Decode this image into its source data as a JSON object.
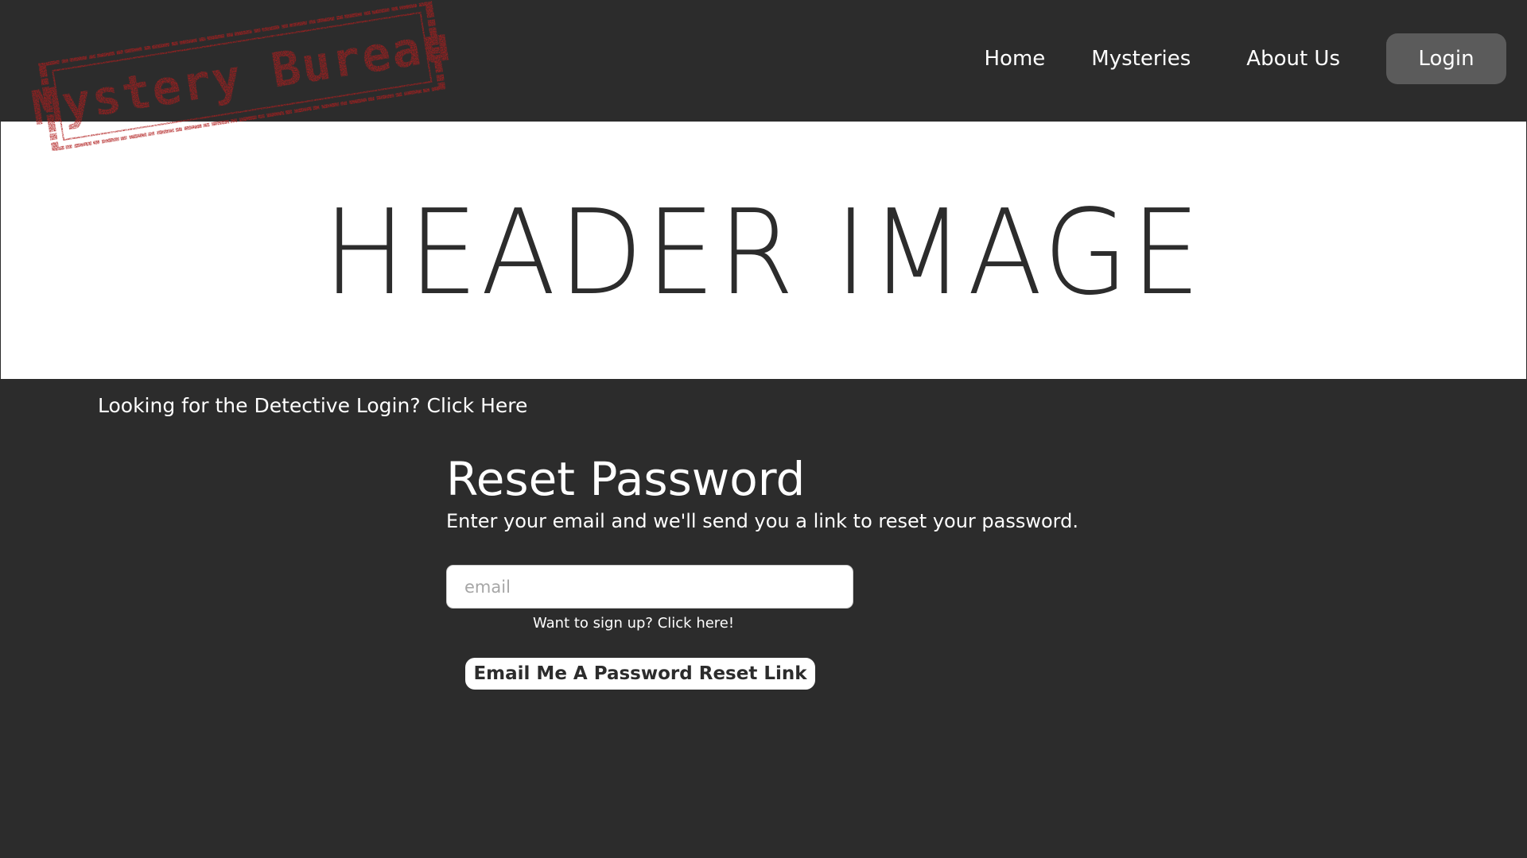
{
  "brand": {
    "logo_text": "Mystery Bureau",
    "logo_color": "#b01e1e"
  },
  "nav": {
    "items": [
      {
        "label": "Home"
      },
      {
        "label": "Mysteries"
      },
      {
        "label": "About Us"
      }
    ],
    "login_label": "Login"
  },
  "header_image": {
    "label": "HEADER IMAGE"
  },
  "detective_link": "Looking for the Detective Login? Click Here",
  "reset": {
    "title": "Reset Password",
    "description": "Enter your email and we'll send you a link to reset your password.",
    "email_placeholder": "email",
    "email_value": "",
    "signup_link": "Want to sign up? Click here!",
    "submit_label": "Email Me A Password Reset Link"
  },
  "colors": {
    "background": "#2c2c2c",
    "header_image_bg": "#ffffff",
    "login_button_bg": "#5b5b5b",
    "text": "#ffffff",
    "stamp_red": "#b01e1e"
  }
}
